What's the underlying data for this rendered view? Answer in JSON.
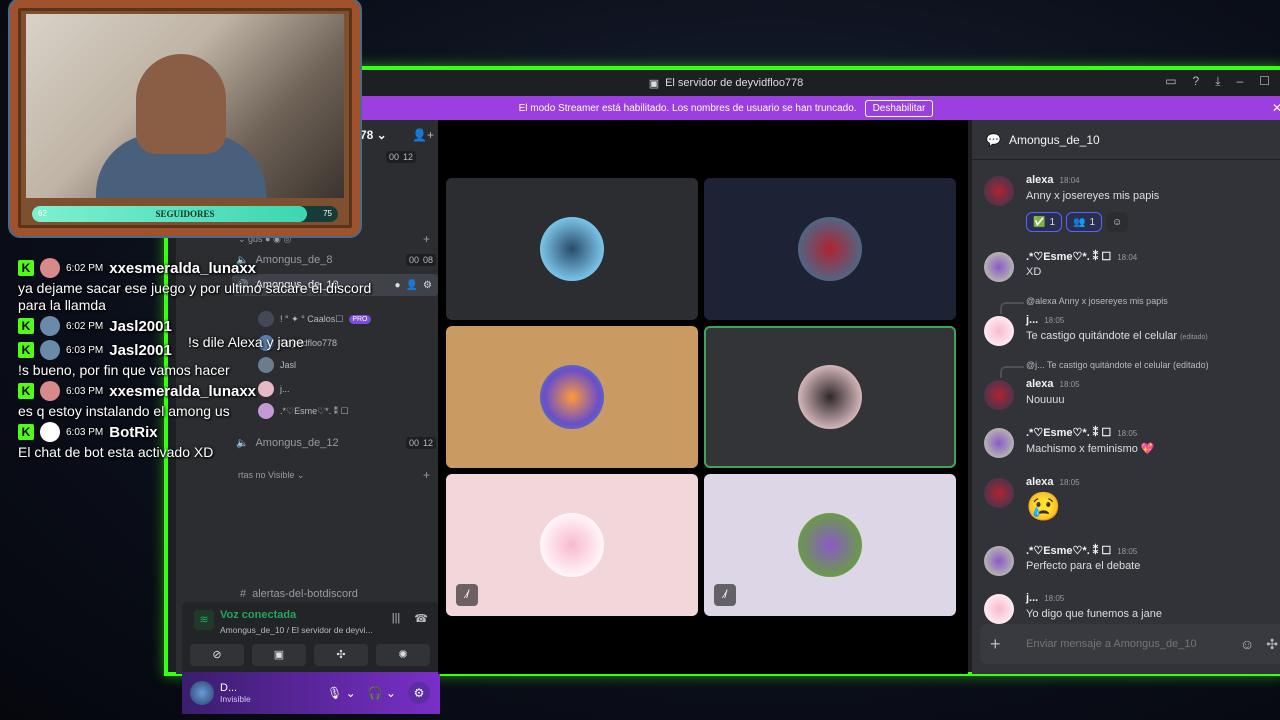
{
  "window": {
    "title": "El servidor de deyvidfloo778",
    "banner_text": "El modo Streamer está habilitado. Los nombres de usuario se han truncado.",
    "banner_button": "Deshabilitar"
  },
  "sidebar": {
    "server_name": "o778 ⌄",
    "channels": [
      {
        "name": "Amongus_de_8",
        "count_a": "00",
        "count_b": "08"
      },
      {
        "name": "Amongus_de_10",
        "active": true
      },
      {
        "name": "Amongus_de_12",
        "count_a": "00",
        "count_b": "12"
      }
    ],
    "members": [
      {
        "name": "! ° ✦ ° Caalos☐",
        "badge": "PRO"
      },
      {
        "name": "Deyvidfloo778"
      },
      {
        "name": "Jasl"
      },
      {
        "name": "j..."
      },
      {
        "name": ".*♡Esme♡*. ⁑ ☐"
      }
    ],
    "category_hidden": "rtas no Visible ⌄",
    "text_channel": "alertas-del-botdiscord",
    "top_counts": [
      "00",
      "12"
    ]
  },
  "voice_panel": {
    "status": "Voz conectada",
    "location": "Amongus_de_10 / El servidor de deyvi..."
  },
  "user_panel": {
    "name": "D...",
    "status": "Invisible"
  },
  "chat": {
    "channel": "Amongus_de_10",
    "placeholder": "Enviar mensaje a Amongus_de_10",
    "messages": [
      {
        "author": "alexa",
        "time": "18:04",
        "text": "Anny x josereyes mis papis"
      },
      {
        "author": ".*♡Esme♡*. ⁑ ☐",
        "time": "18:04",
        "text": "XD"
      },
      {
        "reply": "@alexa Anny x josereyes mis papis",
        "author": "j...",
        "time": "18:05",
        "text": "Te castigo quitándote el celular",
        "edited": "(editado)"
      },
      {
        "reply": "@j... Te castigo quitándote el celular (editado)",
        "author": "alexa",
        "time": "18:05",
        "text": "Nouuuu"
      },
      {
        "author": ".*♡Esme♡*. ⁑ ☐",
        "time": "18:05",
        "text": "Machismo x feminismo 💖"
      },
      {
        "author": "alexa",
        "time": "18:05",
        "text": "😢"
      },
      {
        "author": ".*♡Esme♡*. ⁑ ☐",
        "time": "18:05",
        "text": "Perfecto para el debate"
      },
      {
        "author": "j...",
        "time": "18:05",
        "text": "Yo digo que funemos a jane"
      }
    ],
    "reactions": [
      {
        "emoji": "✅",
        "count": "1"
      },
      {
        "emoji": "👥",
        "count": "1"
      }
    ]
  },
  "kick_chat": [
    {
      "time": "6:02 PM",
      "user": "xxesmeralda_lunaxx",
      "text": "ya dejame sacar ese juego y por ultimo sacare el discord para la llamda"
    },
    {
      "time": "6:02 PM",
      "user": "Jasl2001",
      "text": "!s dile Alexa y jane"
    },
    {
      "time": "6:03 PM",
      "user": "Jasl2001",
      "text": "!s bueno, por fin que vamos hacer"
    },
    {
      "time": "6:03 PM",
      "user": "xxesmeralda_lunaxx",
      "text": "es q estoy instalando el among us"
    },
    {
      "time": "6:03 PM",
      "user": "BotRix",
      "text": "El chat de bot esta activado XD"
    }
  ],
  "webcam": {
    "bar_label": "SEGUIDORES",
    "bar_min": "62",
    "bar_max": "75",
    "progress": 0.9
  },
  "colors": {
    "frame_accent": "#39ff14",
    "banner": "#9b3fe0",
    "voice_connected": "#23a55a",
    "kick_green": "#53fc18"
  }
}
